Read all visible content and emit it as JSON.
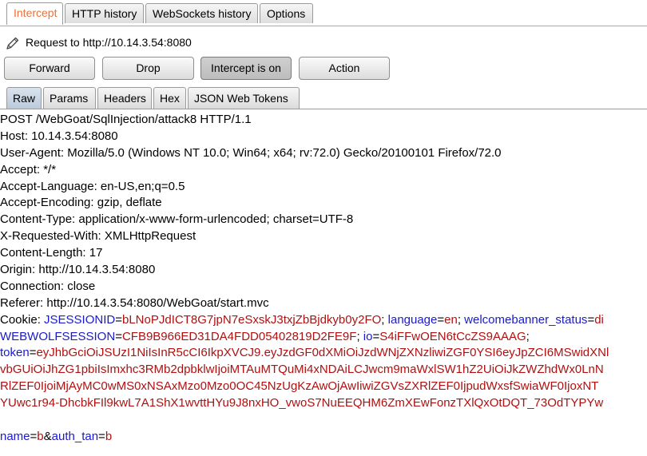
{
  "top_tabs": [
    {
      "label": "Intercept"
    },
    {
      "label": "HTTP history"
    },
    {
      "label": "WebSockets history"
    },
    {
      "label": "Options"
    }
  ],
  "request_info": "Request to http://10.14.3.54:8080",
  "buttons": {
    "forward": "Forward",
    "drop": "Drop",
    "intercept": "Intercept is on",
    "action": "Action"
  },
  "sub_tabs": [
    {
      "label": "Raw"
    },
    {
      "label": "Params"
    },
    {
      "label": "Headers"
    },
    {
      "label": "Hex"
    },
    {
      "label": "JSON Web Tokens"
    }
  ],
  "request": {
    "lines": [
      "POST /WebGoat/SqlInjection/attack8 HTTP/1.1",
      "Host: 10.14.3.54:8080",
      "User-Agent: Mozilla/5.0 (Windows NT 10.0; Win64; x64; rv:72.0) Gecko/20100101 Firefox/72.0",
      "Accept: */*",
      "Accept-Language: en-US,en;q=0.5",
      "Accept-Encoding: gzip, deflate",
      "Content-Type: application/x-www-form-urlencoded; charset=UTF-8",
      "X-Requested-With: XMLHttpRequest",
      "Content-Length: 17",
      "Origin: http://10.14.3.54:8080",
      "Connection: close",
      "Referer: http://10.14.3.54:8080/WebGoat/start.mvc"
    ],
    "cookie_prefix": "Cookie: ",
    "cookie": {
      "jsessionid_key": "JSESSIONID",
      "eq1": "=",
      "jsessionid_val": "bLNoPJdICT8G7jpN7eSxskJ3txjZbBjdkyb0y2FO",
      "sep1": "; ",
      "language_key": "language",
      "eq2": "=",
      "language_val": "en",
      "sep2": "; ",
      "banner_key": "welcomebanner_status",
      "eq3": "=",
      "banner_val": "di"
    },
    "cookie2": {
      "ww_key": "WEBWOLFSESSION",
      "eq1": "=",
      "ww_val": "CFB9B966ED31DA4FDD05402819D2FE9F",
      "sep1": "; ",
      "io_key": "io",
      "eq2": "=",
      "io_val": "S4iFFwOEN6tCcZS9AAAG",
      "sep2": ";"
    },
    "token_key": "token",
    "token_eq": "=",
    "token_lines": [
      "eyJhbGciOiJSUzI1NiIsInR5cCI6IkpXVCJ9.eyJzdGF0dXMiOiJzdWNjZXNzliwiZGF0YSI6eyJpZCI6MSwidXNl",
      "vbGUiOiJhZG1pbiIsImxhc3RMb2dpbklwIjoiMTAuMTQuMi4xNDAiLCJwcm9maWxlSW1hZ2UiOiJkZWZhdWx0LnN",
      "RlZEF0IjoiMjAyMC0wMS0xNSAxMzo0Mzo0OC45NzUgKzAwOjAwIiwiZGVsZXRlZEF0IjpudWxsfSwiaWF0IjoxNT",
      "YUwc1r94-DhcbkFIl9kwL7A1ShX1wvttHYu9J8nxHO_vwoS7NuEEQHM6ZmXEwFonzTXlQxOtDQT_73OdTYPYw"
    ],
    "body": {
      "name_key": "name",
      "eq1": "=",
      "name_val": "b",
      "amp": "&",
      "auth_key": "auth_tan",
      "eq2": "=",
      "auth_val": "b"
    }
  }
}
